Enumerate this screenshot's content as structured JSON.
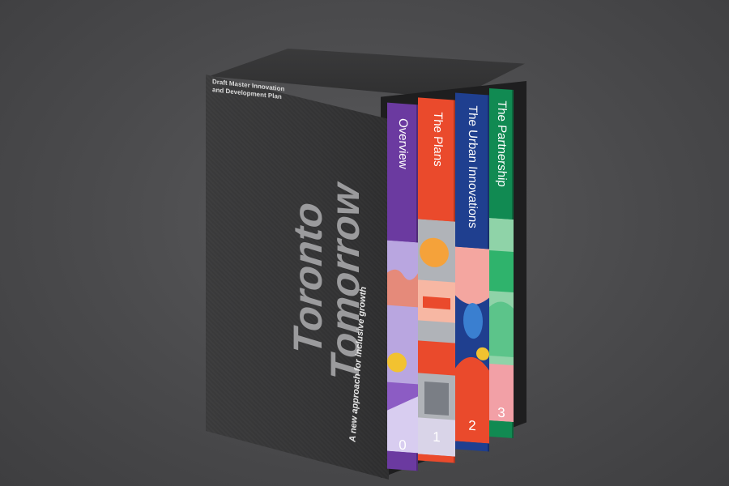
{
  "case": {
    "draft_line1": "Draft Master Innovation",
    "draft_line2": "and Development Plan",
    "title_line1": "Toronto",
    "title_line2": "Tomorrow",
    "tagline": "A new approach for inclusive growth"
  },
  "books": [
    {
      "title": "Overview",
      "number": "0",
      "color": "#6b3aa0"
    },
    {
      "title": "The Plans",
      "number": "1",
      "color": "#ea4a2c"
    },
    {
      "title": "The Urban Innovations",
      "number": "2",
      "color": "#1f3f8f"
    },
    {
      "title": "The Partnership",
      "number": "3",
      "color": "#118a52"
    }
  ],
  "colors": {
    "background": "#4a4a4c",
    "slipcase": "#353536",
    "title_text": "#9b9b9d"
  }
}
